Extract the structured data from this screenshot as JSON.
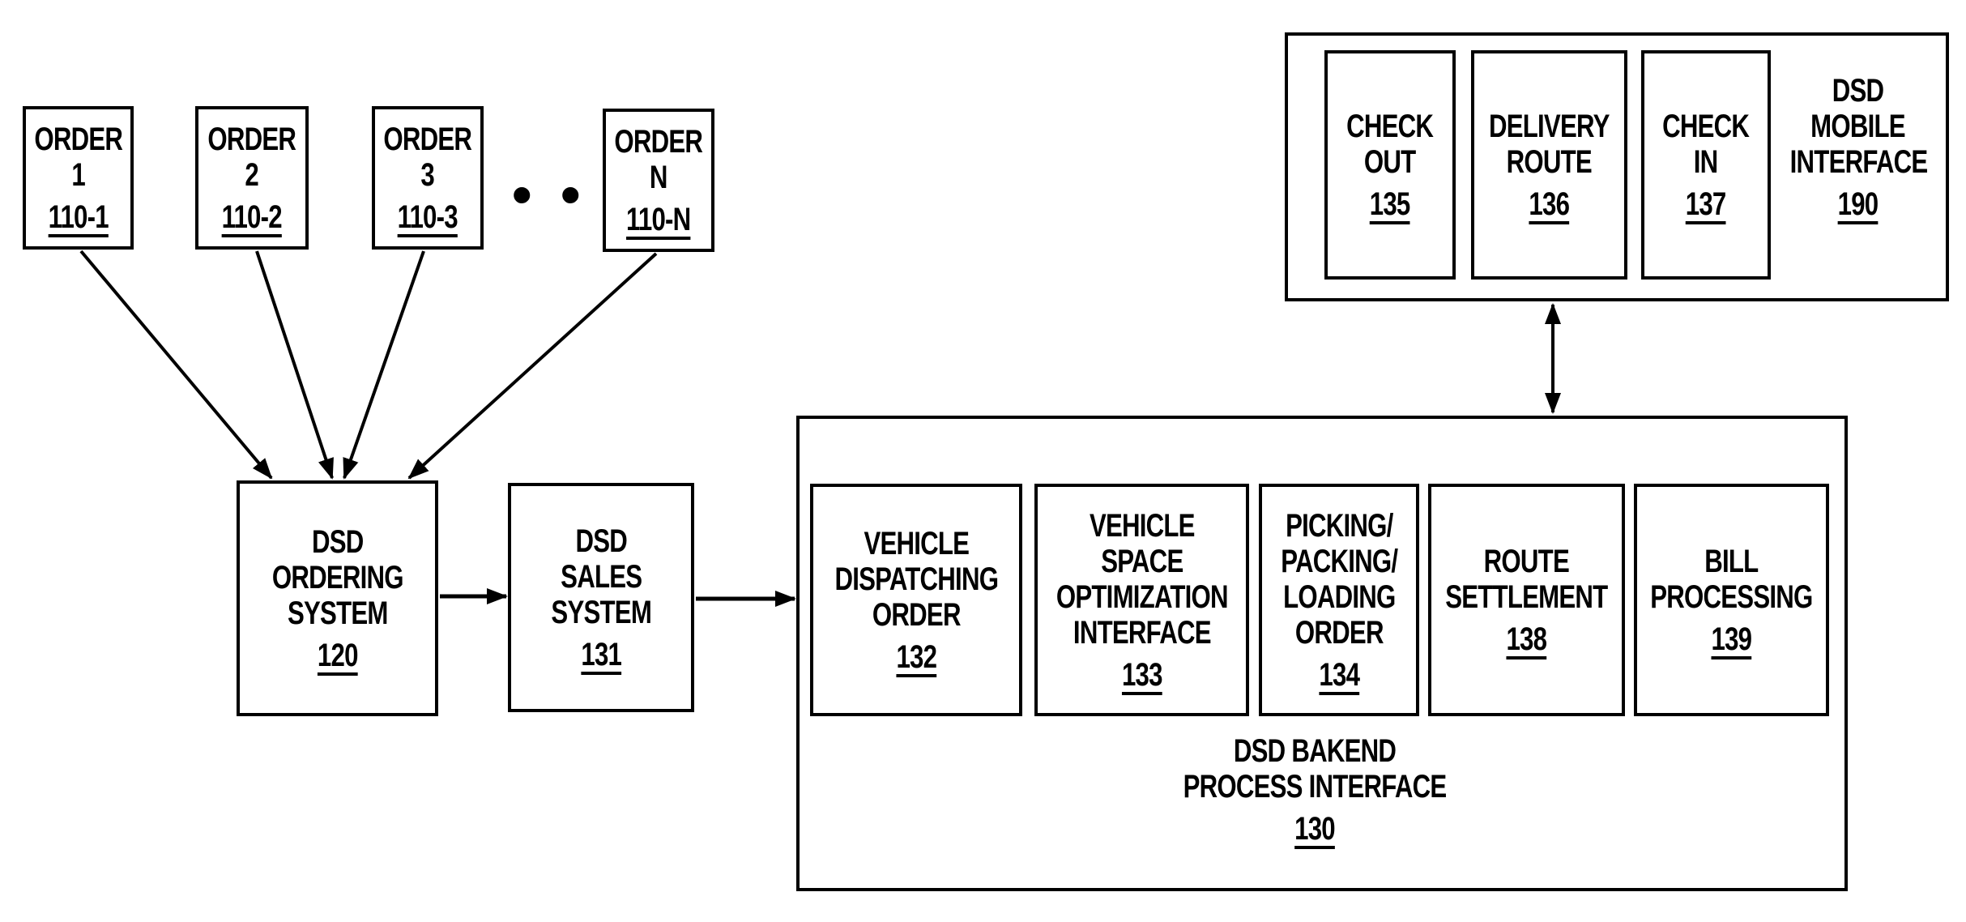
{
  "orders": [
    {
      "title": "ORDER",
      "num": "1",
      "ref": "110-1"
    },
    {
      "title": "ORDER",
      "num": "2",
      "ref": "110-2"
    },
    {
      "title": "ORDER",
      "num": "3",
      "ref": "110-3"
    },
    {
      "title": "ORDER",
      "num": "N",
      "ref": "110-N"
    }
  ],
  "ellipsis": "• • •",
  "ordering_system": {
    "lines": [
      "DSD",
      "ORDERING",
      "SYSTEM"
    ],
    "ref": "120"
  },
  "sales_system": {
    "lines": [
      "DSD",
      "SALES",
      "SYSTEM"
    ],
    "ref": "131"
  },
  "backend": {
    "lines": [
      "DSD BAKEND",
      "PROCESS INTERFACE"
    ],
    "ref": "130",
    "modules": [
      {
        "lines": [
          "VEHICLE",
          "DISPATCHING",
          "ORDER"
        ],
        "ref": "132"
      },
      {
        "lines": [
          "VEHICLE",
          "SPACE",
          "OPTIMIZATION",
          "INTERFACE"
        ],
        "ref": "133"
      },
      {
        "lines": [
          "PICKING/",
          "PACKING/",
          "LOADING",
          "ORDER"
        ],
        "ref": "134"
      },
      {
        "lines": [
          "ROUTE",
          "SETTLEMENT"
        ],
        "ref": "138"
      },
      {
        "lines": [
          "BILL",
          "PROCESSING"
        ],
        "ref": "139"
      }
    ]
  },
  "mobile": {
    "lines": [
      "DSD",
      "MOBILE",
      "INTERFACE"
    ],
    "ref": "190",
    "modules": [
      {
        "lines": [
          "CHECK",
          "OUT"
        ],
        "ref": "135"
      },
      {
        "lines": [
          "DELIVERY",
          "ROUTE"
        ],
        "ref": "136"
      },
      {
        "lines": [
          "CHECK",
          "IN"
        ],
        "ref": "137"
      }
    ]
  }
}
